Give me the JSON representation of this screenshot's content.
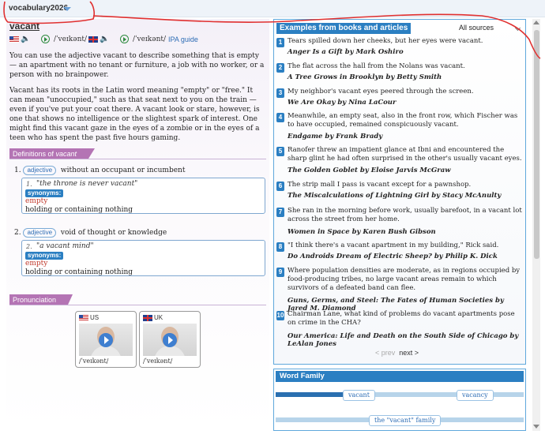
{
  "tab": {
    "title": "vocabulary2026"
  },
  "entry": {
    "headword": "vacant",
    "pron_us": "/ˈveɪkənt/",
    "pron_uk": "/ˈveɪkənt/",
    "ipa_guide": "IPA guide",
    "para1": "You can use the adjective vacant to describe something that is empty — an apartment with no tenant or furniture, a job with no worker, or a person with no brainpower.",
    "para2": "Vacant has its roots in the Latin word meaning \"empty\" or \"free.\" It can mean \"unoccupied,\" such as that seat next to you on the train — even if you've put your coat there. A vacant look or stare, however, is one that shows no intelligence or the slightest spark of interest. One might find this vacant gaze in the eyes of a zombie or in the eyes of a teen who has spent the past five hours gaming."
  },
  "definitions": {
    "header_prefix": "Definitions of ",
    "header_word": "vacant",
    "senses": [
      {
        "num": "1.",
        "pos": "adjective",
        "gloss": "without an occupant or incumbent",
        "ex_num": "1.",
        "example": "\"the throne is never vacant\"",
        "syn_label": "synonyms:",
        "syn": "empty",
        "syn_def": "holding or containing nothing"
      },
      {
        "num": "2.",
        "pos": "adjective",
        "gloss": "void of thought or knowledge",
        "ex_num": "2.",
        "example": "\"a vacant mind\"",
        "syn_label": "synonyms:",
        "syn": "empty",
        "syn_def": "holding or containing nothing"
      }
    ]
  },
  "pronunciation": {
    "header": "Pronunciation",
    "us_label": "US",
    "us_ipa": "/ˈveɪkənt/",
    "uk_label": "UK",
    "uk_ipa": "/ˈveɪkənt/"
  },
  "examples": {
    "header": "Examples from books and articles",
    "source_filter": "All sources",
    "items": [
      {
        "n": "1",
        "text": "Tears spilled down her cheeks, but her eyes were vacant.",
        "source": "Anger Is a Gift by Mark Oshiro"
      },
      {
        "n": "2",
        "text": "The flat across the hall from the Nolans was vacant.",
        "source": "A Tree Grows in Brooklyn by Betty Smith"
      },
      {
        "n": "3",
        "text": "My neighbor's vacant eyes peered through the screen.",
        "source": "We Are Okay by Nina LaCour"
      },
      {
        "n": "4",
        "text": "Meanwhile, an empty seat, also in the front row, which Fischer was to have occupied, remained conspicuously vacant.",
        "source": "Endgame by Frank Brady"
      },
      {
        "n": "5",
        "text": "Ranofer threw an impatient glance at Ibni and encountered the sharp glint he had often surprised in the other's usually vacant eyes.",
        "source": "The Golden Goblet by Eloise Jarvis McGraw"
      },
      {
        "n": "6",
        "text": "The strip mall I pass is vacant except for a pawnshop.",
        "source": "The Miscalculations of Lightning Girl by Stacy McAnulty"
      },
      {
        "n": "7",
        "text": "She ran in the morning before work, usually barefoot, in a vacant lot across the street from her home.",
        "source": "Women in Space by Karen Bush Gibson"
      },
      {
        "n": "8",
        "text": "\"I think there's a vacant apartment in my building,\" Rick said.",
        "source": "Do Androids Dream of Electric Sheep? by Philip K. Dick"
      },
      {
        "n": "9",
        "text": "Where population densities are moderate, as in regions occupied by food-producing tribes, no large vacant areas remain to which survivors of a defeated band can flee.",
        "source": "Guns, Germs, and Steel: The Fates of Human Societies by Jared M. Diamond"
      },
      {
        "n": "10",
        "text": "Chairman Lane, what kind of problems do vacant apartments pose on crime in the CHA?",
        "source": "Our America: Life and Death on the South Side of Chicago by LeAlan Jones"
      }
    ],
    "prev": "< prev",
    "next": "next >"
  },
  "word_family": {
    "header": "Word Family",
    "items": [
      "vacant",
      "vacancy"
    ],
    "family_link": "the \"vacant\" family"
  },
  "colors": {
    "accent": "#2b7fc2",
    "section": "#b474b4",
    "annotation": "#e03030"
  }
}
